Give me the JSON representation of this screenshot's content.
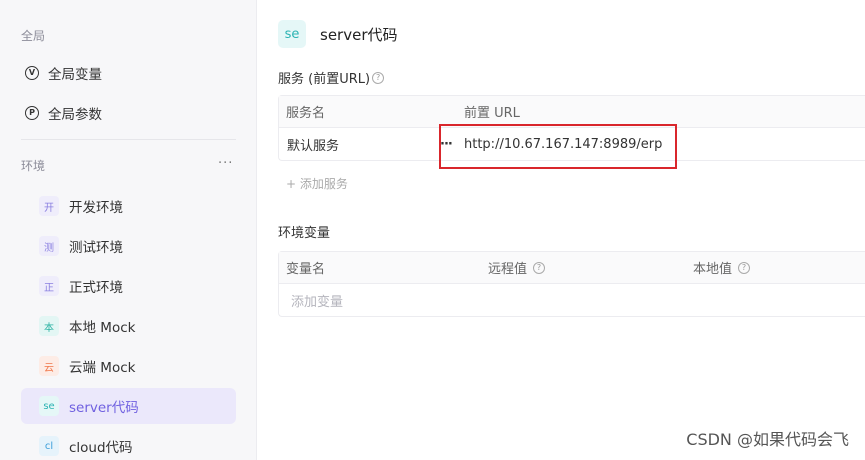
{
  "sidebar": {
    "global_label": "全局",
    "global_items": [
      {
        "icon": "V",
        "label": "全局变量"
      },
      {
        "icon": "P",
        "label": "全局参数"
      }
    ],
    "env_label": "环境",
    "env_more": "···",
    "environments": [
      {
        "badge": "开",
        "label": "开发环境",
        "badge_bg": "#efedfb",
        "badge_fg": "#8a7fe0"
      },
      {
        "badge": "测",
        "label": "测试环境",
        "badge_bg": "#efedfb",
        "badge_fg": "#8a7fe0"
      },
      {
        "badge": "正",
        "label": "正式环境",
        "badge_bg": "#efedfb",
        "badge_fg": "#8a7fe0"
      },
      {
        "badge": "本",
        "label": "本地 Mock",
        "badge_bg": "#e3f6f4",
        "badge_fg": "#2bb3a3"
      },
      {
        "badge": "云",
        "label": "云端 Mock",
        "badge_bg": "#fdece6",
        "badge_fg": "#f0774a"
      },
      {
        "badge": "se",
        "label": "server代码",
        "badge_bg": "#e5f7f7",
        "badge_fg": "#2bb3b3"
      },
      {
        "badge": "cl",
        "label": "cloud代码",
        "badge_bg": "#e6f3fb",
        "badge_fg": "#3b9ed9"
      }
    ]
  },
  "main": {
    "env_badge": "se",
    "env_title": "server代码",
    "services_title": "服务 (前置URL)",
    "services_help": "?",
    "services_table": {
      "headers": [
        "服务名",
        "前置 URL"
      ],
      "rows": [
        {
          "name": "默认服务",
          "more": "···",
          "url": "http://10.67.167.147:8989/erp"
        }
      ]
    },
    "add_service": "+ 添加服务",
    "vars_title": "环境变量",
    "vars_table": {
      "headers": [
        "变量名",
        "远程值",
        "本地值"
      ],
      "help": "?",
      "placeholder": "添加变量"
    }
  },
  "watermark": "CSDN @如果代码会飞",
  "colors": {
    "accent": "#7061e0",
    "highlight_border": "#d9262c"
  }
}
